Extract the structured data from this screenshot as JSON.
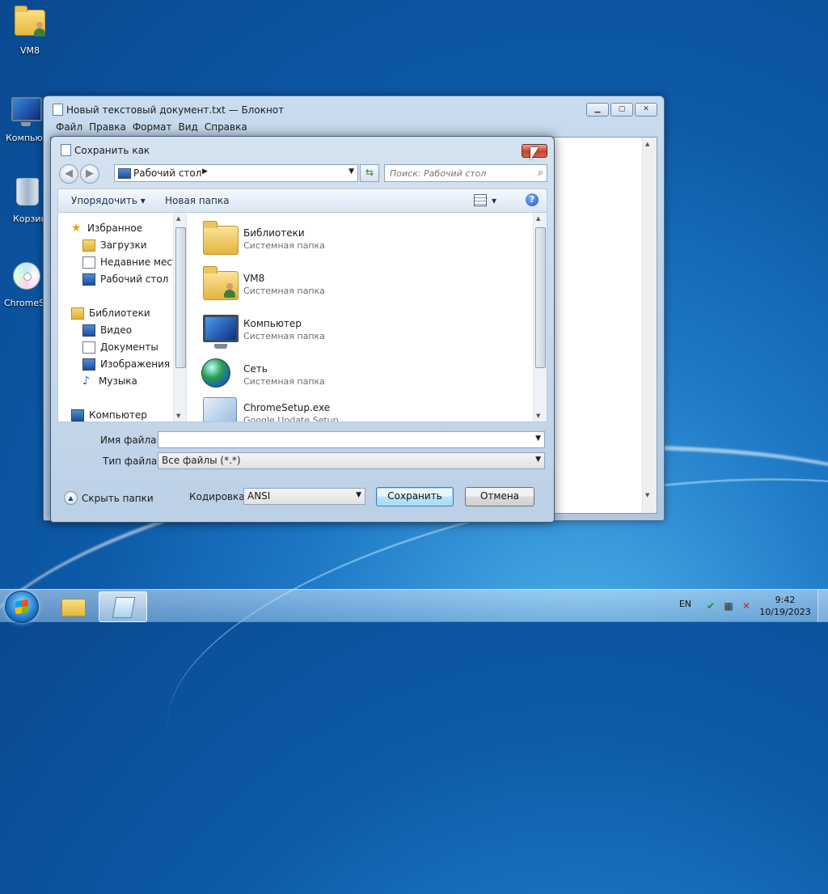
{
  "desktop": {
    "icons": [
      {
        "label": "VM8",
        "icon": "user-folder-icon"
      },
      {
        "label": "Компью",
        "icon": "computer-icon"
      },
      {
        "label": "Корзин",
        "icon": "recycle-bin-icon"
      },
      {
        "label": "ChromeS",
        "icon": "setup-disc-icon"
      }
    ]
  },
  "notepad": {
    "title": "Новый текстовый документ.txt — Блокнот",
    "menu": [
      "Файл",
      "Правка",
      "Формат",
      "Вид",
      "Справка"
    ],
    "minimize": "▁",
    "maximize": "▢",
    "close": "✕"
  },
  "dialog": {
    "title": "Сохранить как",
    "close": "✕",
    "address": {
      "location": "Рабочий стол",
      "separator": "▶",
      "dropdown": "▼"
    },
    "search_placeholder": "Поиск: Рабочий стол",
    "toolbar": {
      "organize": "Упорядочить ▾",
      "new_folder": "Новая папка",
      "view_dropdown": "▾",
      "help": "?"
    },
    "nav": {
      "favorites": "Избранное",
      "downloads": "Загрузки",
      "recent": "Недавние места",
      "desktop": "Рабочий стол",
      "libraries": "Библиотеки",
      "video": "Видео",
      "documents": "Документы",
      "pictures": "Изображения",
      "music": "Музыка",
      "computer": "Компьютер"
    },
    "files": [
      {
        "name": "Библиотеки",
        "type": "Системная папка",
        "icon": "libraries-folder-icon"
      },
      {
        "name": "VM8",
        "type": "Системная папка",
        "icon": "user-folder-icon"
      },
      {
        "name": "Компьютер",
        "type": "Системная папка",
        "icon": "computer-icon"
      },
      {
        "name": "Сеть",
        "type": "Системная папка",
        "icon": "network-globe-icon"
      },
      {
        "name": "ChromeSetup.exe",
        "type": "Google Update Setup",
        "icon": "setup-exe-icon"
      }
    ],
    "filename_label": "Имя файла:",
    "filename_value": "",
    "filetype_label": "Тип файла:",
    "filetype_value": "Все файлы  (*.*)",
    "hide_folders": "Скрыть папки",
    "encoding_label": "Кодировка:",
    "encoding_value": "ANSI",
    "save_button": "Сохранить",
    "cancel_button": "Отмена"
  },
  "taskbar": {
    "language": "EN",
    "time": "9:42",
    "date": "10/19/2023"
  },
  "colors": {
    "desktop_blue": "#0d5aa7",
    "close_red": "#c5432e",
    "default_button": "#a7d9f5"
  }
}
